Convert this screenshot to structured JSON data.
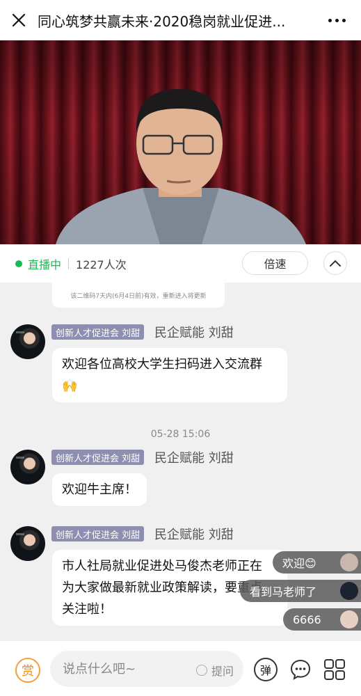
{
  "header": {
    "title": "同心筑梦共赢未来·2020稳岗就业促进..."
  },
  "live": {
    "status": "直播中",
    "viewers": "1227人次",
    "speed_label": "倍速"
  },
  "chat": {
    "image_caption": "该二维码7天内(6月4日前)有效，重新进入将更新",
    "messages": [
      {
        "tag": "创新人才促进会 刘甜",
        "sender": "民企赋能 刘甜",
        "lines": [
          "欢迎各位高校大学生扫码进入交流群",
          "🙌"
        ]
      },
      {
        "tag": "创新人才促进会 刘甜",
        "sender": "民企赋能 刘甜",
        "lines": [
          "欢迎牛主席！"
        ]
      },
      {
        "tag": "创新人才促进会 刘甜",
        "sender": "民企赋能 刘甜",
        "lines": [
          "市人社局就业促进处马俊杰老师正在",
          "为大家做最新就业政策解读，要重点",
          "关注啦！"
        ]
      }
    ],
    "timestamp": "05-28 15:06"
  },
  "danmu": [
    {
      "text": "欢迎😊"
    },
    {
      "text": "看到马老师了"
    },
    {
      "text": "6666"
    }
  ],
  "bottom": {
    "reward_label": "赏",
    "input_placeholder": "说点什么吧~",
    "ask_label": "提问",
    "danmu_toggle_label": "弹"
  }
}
